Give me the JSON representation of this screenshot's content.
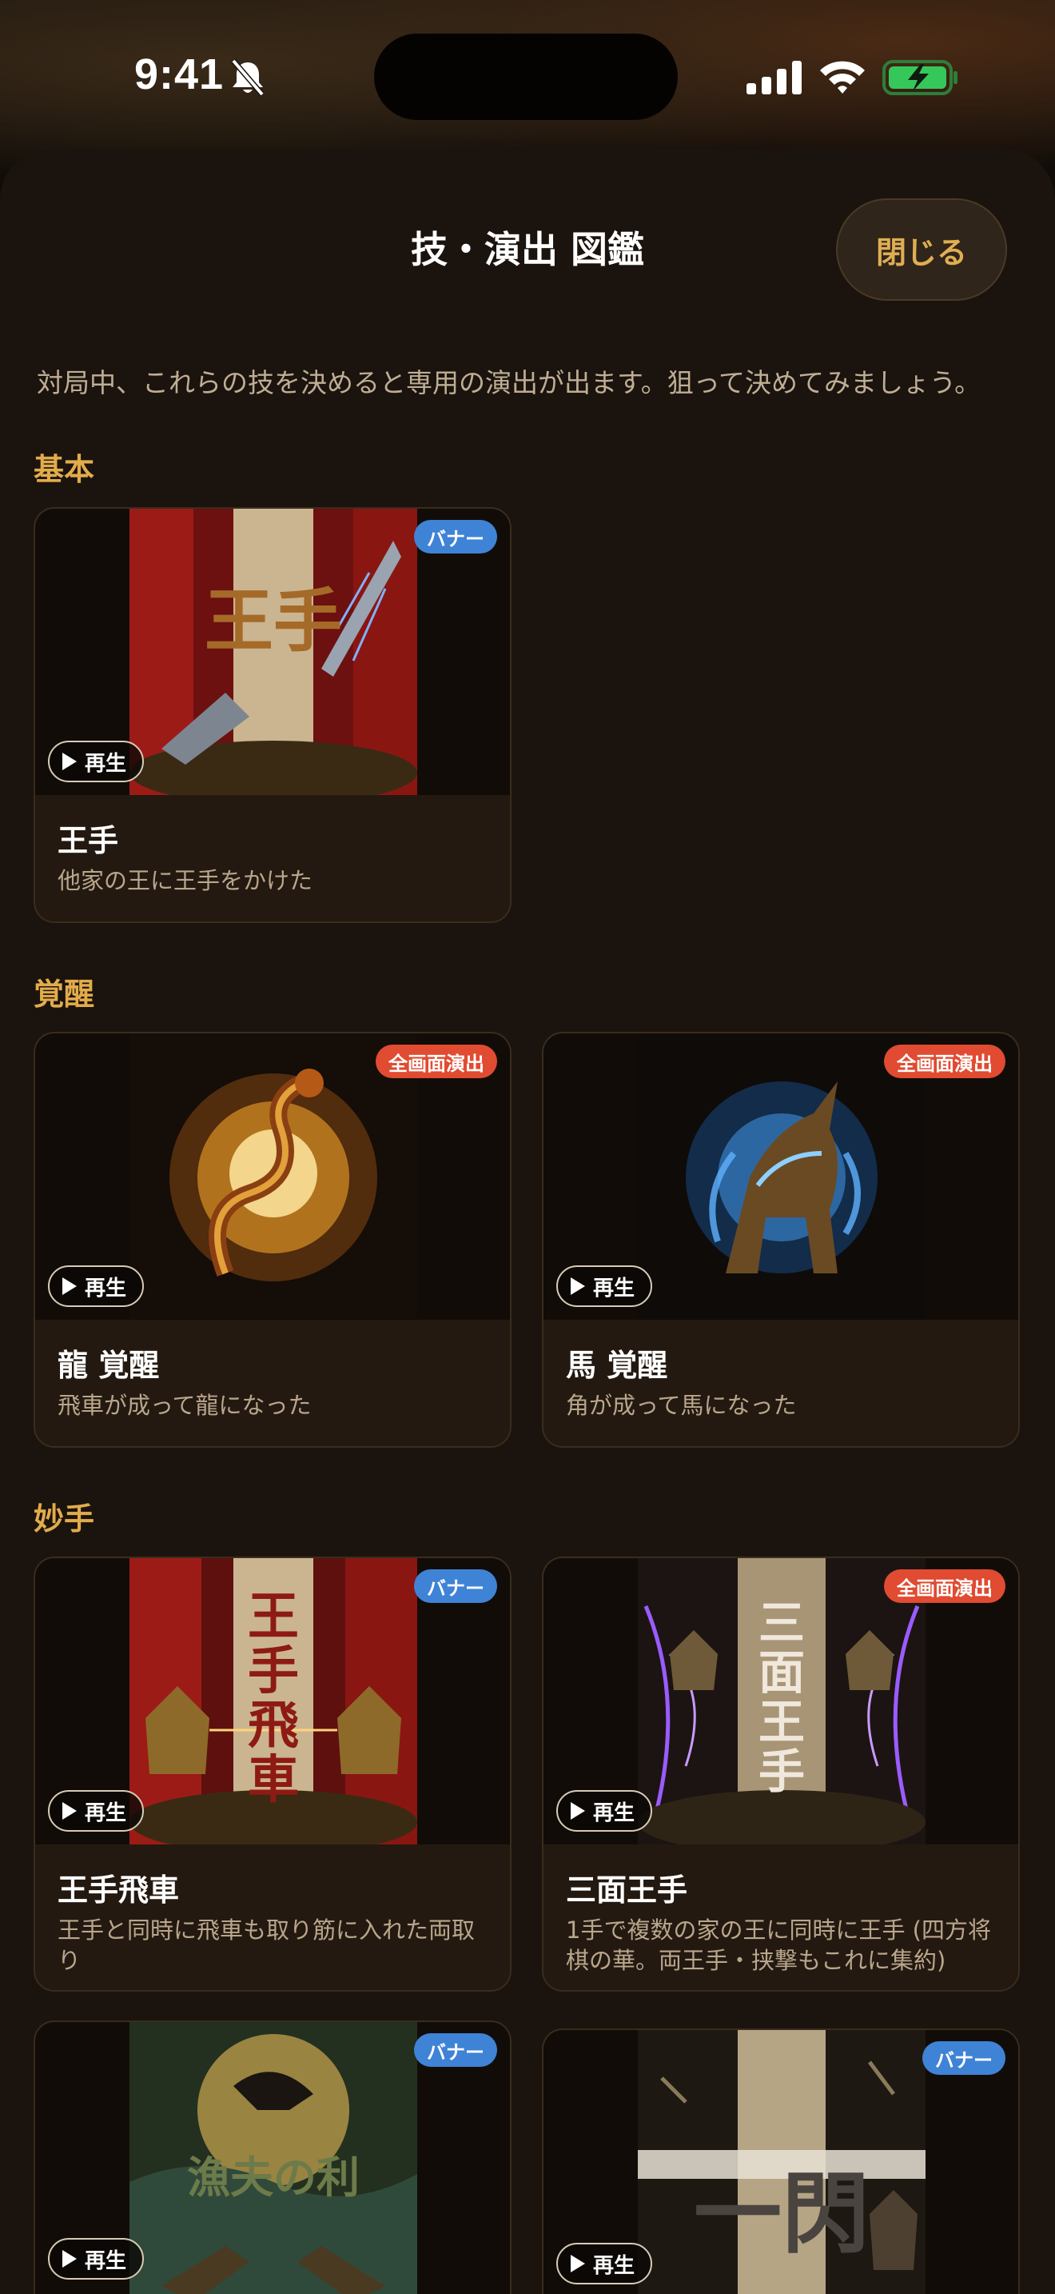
{
  "status_bar": {
    "time": "9:41"
  },
  "sheet": {
    "title": "技・演出 図鑑",
    "close_label": "閉じる",
    "intro": "対局中、これらの技を決めると専用の演出が出ます。狙って決めてみましょう。"
  },
  "play_label": "再生",
  "sections": [
    {
      "title": "基本",
      "cards": [
        {
          "name": "王手",
          "description": "他家の王に王手をかけた",
          "badge": "バナー",
          "badge_type": "banner",
          "art_text": "王手"
        }
      ]
    },
    {
      "title": "覚醒",
      "cards": [
        {
          "name": "龍 覚醒",
          "description": "飛車が成って龍になった",
          "badge": "全画面演出",
          "badge_type": "full"
        },
        {
          "name": "馬 覚醒",
          "description": "角が成って馬になった",
          "badge": "全画面演出",
          "badge_type": "full"
        }
      ]
    },
    {
      "title": "妙手",
      "cards": [
        {
          "name": "王手飛車",
          "description": "王手と同時に飛車も取り筋に入れた両取り",
          "badge": "バナー",
          "badge_type": "banner",
          "art_text": "王手飛車"
        },
        {
          "name": "三面王手",
          "description": "1手で複数の家の王に同時に王手 (四方将棋の華。両王手・挟撃もこれに集約)",
          "badge": "全画面演出",
          "badge_type": "full",
          "art_text": "三面王手"
        },
        {
          "badge": "バナー",
          "badge_type": "banner",
          "art_text": "漁夫の利"
        },
        {
          "badge": "バナー",
          "badge_type": "banner",
          "art_text": "一閃"
        }
      ]
    }
  ]
}
